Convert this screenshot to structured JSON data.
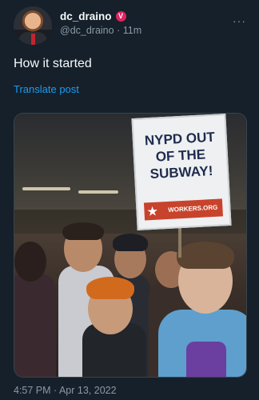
{
  "tweet": {
    "display_name": "dc_draino",
    "verified_badge": "V",
    "handle": "@dc_draino",
    "separator": "·",
    "time_ago": "11m",
    "more_icon": "more-horizontal-icon",
    "text": "How it started",
    "translate_label": "Translate post",
    "timestamp": "4:57 PM · Apr 13, 2022"
  },
  "image": {
    "sign_lines": [
      "NYPD OUT",
      "OF THE",
      "SUBWAY!"
    ],
    "sign_strip": "WORKERS.ORG"
  },
  "colors": {
    "background": "#15202b",
    "primary_text": "#f7f9f9",
    "secondary_text": "#8b98a5",
    "link": "#1d9bf0",
    "badge": "#e0245e"
  }
}
